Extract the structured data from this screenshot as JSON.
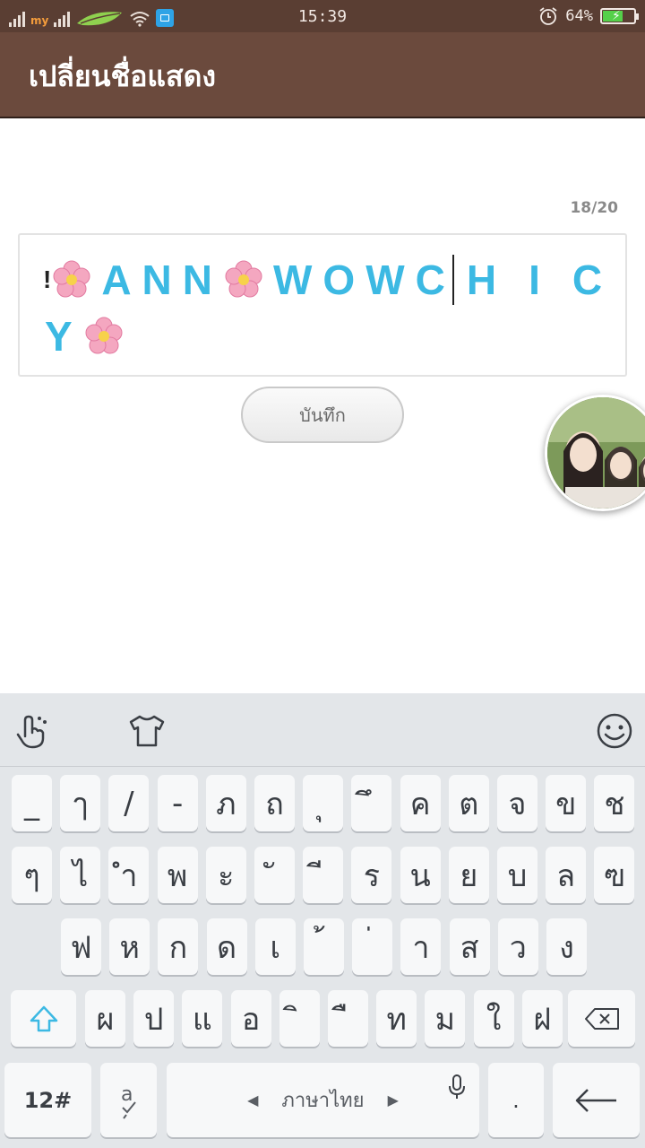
{
  "status_bar": {
    "carrier": "my",
    "time": "15:39",
    "battery_percent": "64%",
    "battery_level": 0.64,
    "icons": [
      "signal-icon",
      "carrier-logo-icon",
      "signal-icon",
      "operator-leaf-icon",
      "wifi-icon",
      "notification-app-icon",
      "alarm-icon",
      "battery-charging-icon"
    ]
  },
  "app_bar": {
    "title": "เปลี่ยนชื่อแสดง"
  },
  "editor": {
    "counter": "18/20",
    "name_prefix": "!",
    "name_segments": [
      "ANN",
      "WOWC",
      "HIC",
      "Y"
    ],
    "emoji": "cherry-blossom-icon"
  },
  "save_button": {
    "label": "บันทึก"
  },
  "chat_head": {
    "icon": "floating-avatar-photo"
  },
  "keyboard": {
    "toolbar": [
      "gesture-typing-icon",
      "theme-shirt-icon",
      "emoji-smiley-icon"
    ],
    "row1": [
      "_",
      "ๅ",
      "/",
      "-",
      "ภ",
      "ถ",
      "ุ",
      "ึ",
      "ค",
      "ต",
      "จ",
      "ข",
      "ช"
    ],
    "row2": [
      "ๆ",
      "ไ",
      "ำ",
      "พ",
      "ะ",
      "ั",
      "ี",
      "ร",
      "น",
      "ย",
      "บ",
      "ล",
      "ฃ"
    ],
    "row3": [
      "ฟ",
      "ห",
      "ก",
      "ด",
      "เ",
      "้",
      "่",
      "า",
      "ส",
      "ว",
      "ง"
    ],
    "row4": [
      "ผ",
      "ป",
      "แ",
      "อ",
      "ิ",
      "ื",
      "ท",
      "ม",
      "ใ",
      "ฝ"
    ],
    "numbers_key": "12#",
    "language_label": "ภาษาไทย",
    "period_key": ".",
    "accent_color": "#3cb9e3"
  }
}
